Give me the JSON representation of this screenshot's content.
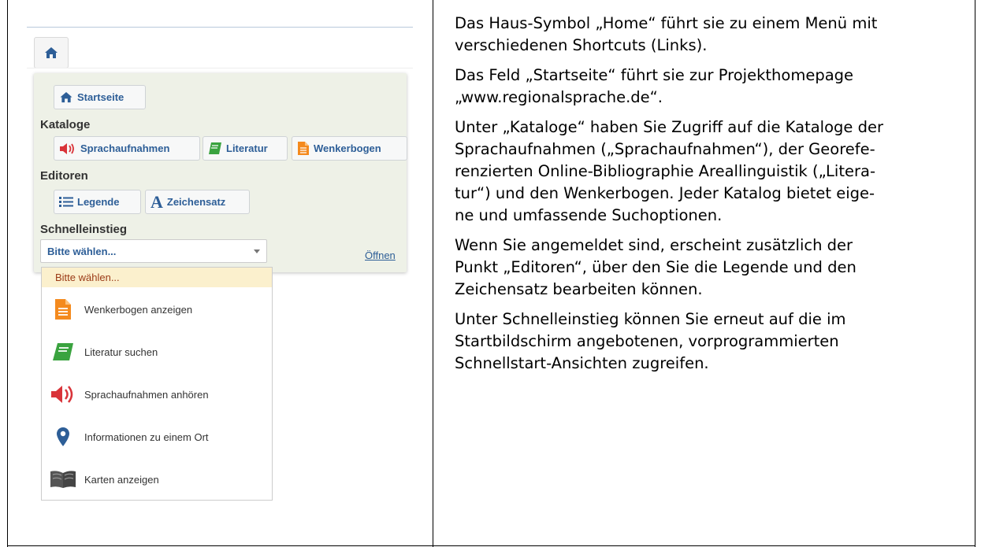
{
  "menu": {
    "startseite_label": "Startseite",
    "kataloge_heading": "Kataloge",
    "sprachaufnahmen_label": "Sprachaufnahmen",
    "literatur_label": "Literatur",
    "wenkerbogen_label": "Wenkerbogen",
    "editoren_heading": "Editoren",
    "legende_label": "Legende",
    "zeichensatz_label": "Zeichensatz",
    "schnelleinstieg_heading": "Schnelleinstieg",
    "select_value": "Bitte wählen...",
    "open_link": "Öffnen"
  },
  "dropdown": {
    "first": "Bitte wählen...",
    "items": [
      {
        "label": "Wenkerbogen anzeigen",
        "icon": "document-icon"
      },
      {
        "label": "Literatur suchen",
        "icon": "book-icon"
      },
      {
        "label": "Sprachaufnahmen anhören",
        "icon": "speaker-icon"
      },
      {
        "label": "Informationen zu einem Ort",
        "icon": "location-pin-icon"
      },
      {
        "label": "Karten anzeigen",
        "icon": "map-book-icon"
      }
    ]
  },
  "text": {
    "p1_l1": "Das Haus-Symbol „Home“ führt sie zu einem Menü mit",
    "p1_l2": "verschiedenen Shortcuts (Links).",
    "p2_l1": "Das Feld „Startseite“ führt sie zur Projekthomepage",
    "p2_l2": "„www.regionalsprache.de“.",
    "p3_l1": "Unter „Kataloge“ haben Sie Zugriff auf die Kataloge der",
    "p3_l2": "Sprachaufnahmen („Sprachaufnahmen“), der Georefe-",
    "p3_l3": "renzierten Online-Bibliographie Areallinguistik („Litera-",
    "p3_l4": "tur“) und den Wenkerbogen. Jeder Katalog bietet eige-",
    "p3_l5": "ne und umfassende Suchoptionen.",
    "p4_l1": "Wenn Sie angemeldet sind, erscheint zusätzlich der",
    "p4_l2": "Punkt „Editoren“, über den Sie die Legende und den",
    "p4_l3": "Zeichensatz bearbeiten können.",
    "p5_l1": "Unter Schnelleinstieg können Sie erneut auf die im",
    "p5_l2": "Startbildschirm angebotenen, vorprogrammierten",
    "p5_l3": "Schnellstart-Ansichten zugreifen."
  },
  "colors": {
    "link": "#2d5e97",
    "panel_bg": "#eef1e7",
    "speaker": "#d9343a",
    "book": "#3aa33f",
    "document": "#f48a1e",
    "pin": "#2d5e97"
  }
}
